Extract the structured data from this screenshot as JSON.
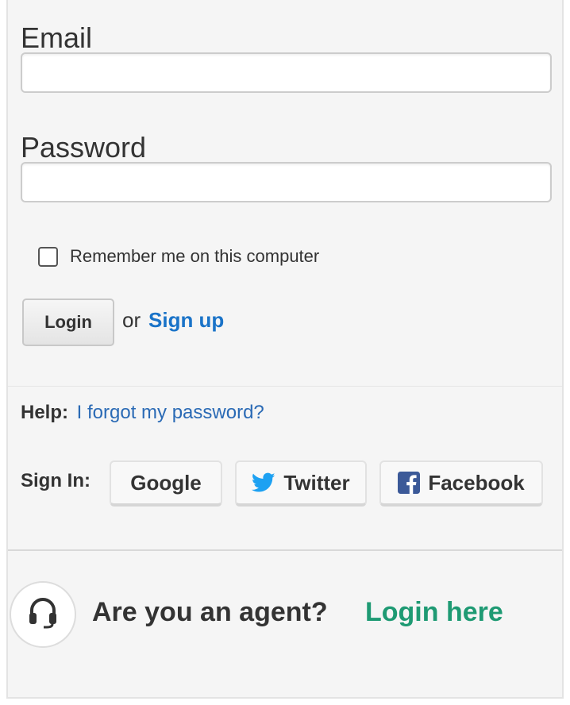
{
  "form": {
    "email_label": "Email",
    "email_value": "",
    "password_label": "Password",
    "password_value": "",
    "remember_label": "Remember me on this computer",
    "remember_checked": false,
    "login_button": "Login",
    "or_text": "or",
    "signup_link": "Sign up"
  },
  "help": {
    "label": "Help:",
    "forgot_link": "I forgot my password?"
  },
  "signin": {
    "label": "Sign In:",
    "providers": [
      {
        "name": "Google",
        "icon": "none"
      },
      {
        "name": "Twitter",
        "icon": "twitter-bird-icon",
        "color": "#1da1f2"
      },
      {
        "name": "Facebook",
        "icon": "facebook-icon",
        "color": "#3b5998"
      }
    ]
  },
  "agent": {
    "icon": "headset-icon",
    "question": "Are you an agent?",
    "login_link": "Login here"
  },
  "colors": {
    "link_blue": "#1a73c8",
    "agent_green": "#1e9a73",
    "panel_bg": "#f5f5f5"
  }
}
